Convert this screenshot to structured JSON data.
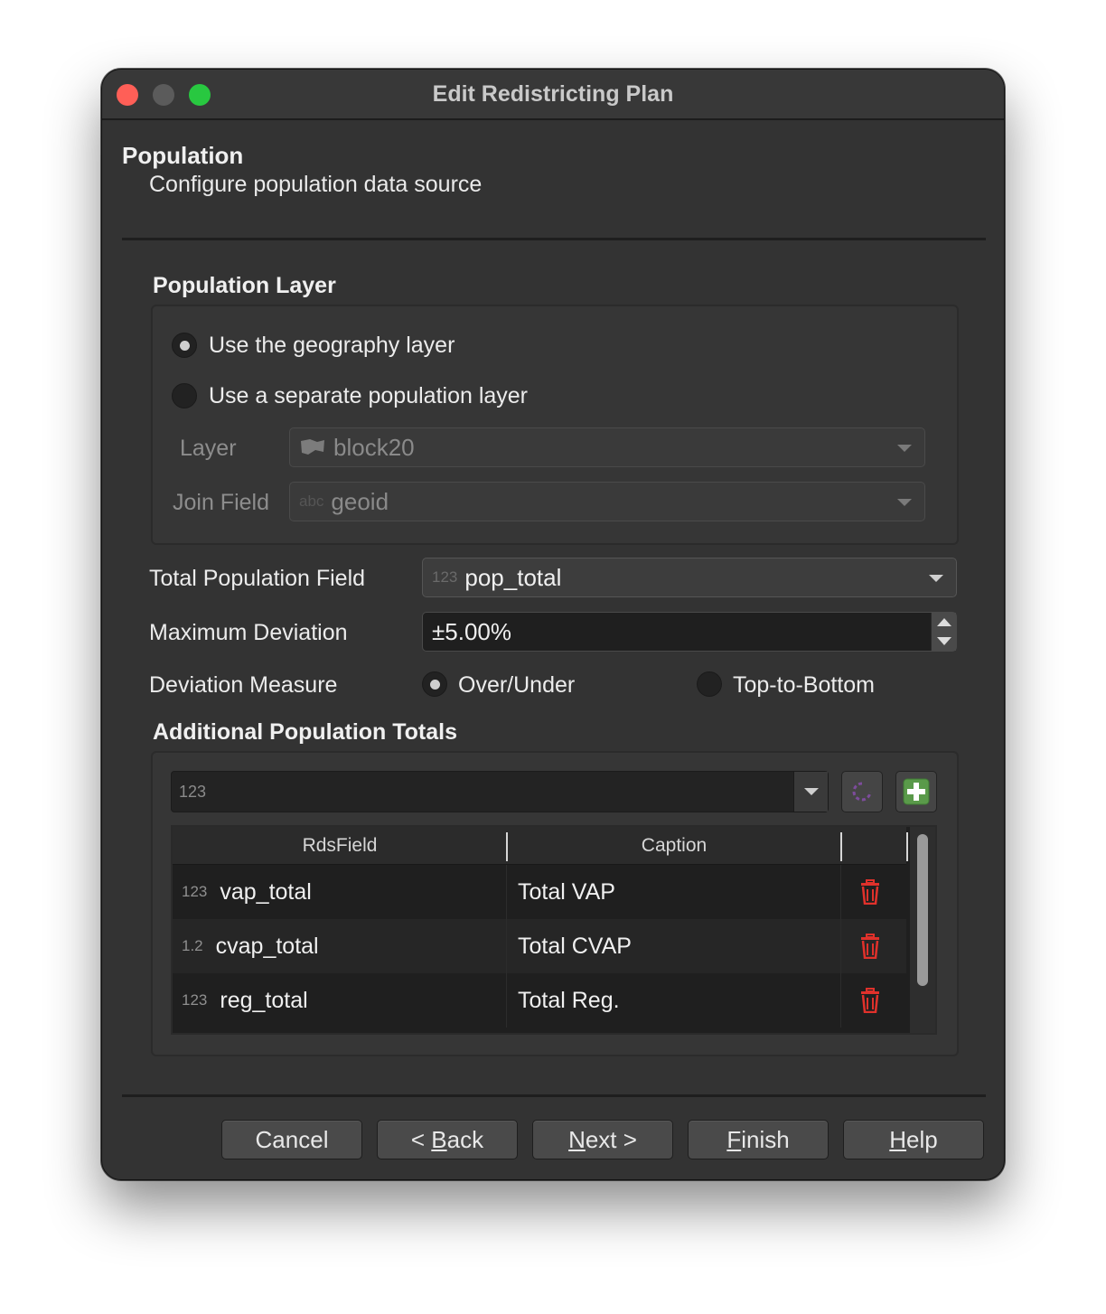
{
  "window": {
    "title": "Edit Redistricting Plan"
  },
  "page": {
    "heading": "Population",
    "subheading": "Configure population data source"
  },
  "population_layer": {
    "group_title": "Population Layer",
    "option_geography": "Use the geography layer",
    "option_separate": "Use a separate population layer",
    "selected": "option_geography",
    "layer_label": "Layer",
    "layer_value": "block20",
    "join_field_label": "Join Field",
    "join_field_type": "abc",
    "join_field_value": "geoid"
  },
  "fields": {
    "total_pop_label": "Total Population Field",
    "total_pop_type": "123",
    "total_pop_value": "pop_total",
    "max_dev_label": "Maximum Deviation",
    "max_dev_value": "±5.00%",
    "dev_measure_label": "Deviation Measure",
    "dev_over_under": "Over/Under",
    "dev_top_bottom": "Top-to-Bottom",
    "dev_selected": "Over/Under"
  },
  "additional": {
    "group_title": "Additional Population Totals",
    "field_selector_type": "123",
    "columns": [
      "RdsField",
      "Caption"
    ],
    "rows": [
      {
        "type": "123",
        "field": "vap_total",
        "caption": "Total VAP"
      },
      {
        "type": "1.2",
        "field": "cvap_total",
        "caption": "Total CVAP"
      },
      {
        "type": "123",
        "field": "reg_total",
        "caption": "Total Reg."
      }
    ]
  },
  "buttons": {
    "cancel": "Cancel",
    "back_prefix": "< ",
    "back_mnemonic": "B",
    "back_rest": "ack",
    "next_mnemonic": "N",
    "next_rest": "ext >",
    "finish_mnemonic": "F",
    "finish_rest": "inish",
    "help_mnemonic": "H",
    "help_rest": "elp"
  },
  "colors": {
    "window_bg": "#333333",
    "delete_icon": "#e0312b",
    "add_icon": "#5cb85c",
    "close": "#ff5f57",
    "maximize": "#28c840"
  }
}
